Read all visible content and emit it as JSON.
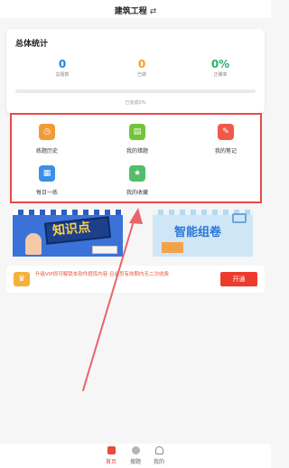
{
  "header": {
    "title": "建筑工程",
    "switch_icon": "swap-icon"
  },
  "stats": {
    "heading": "总体统计",
    "items": [
      {
        "value": "0",
        "label": "总题数"
      },
      {
        "value": "0",
        "label": "已做"
      },
      {
        "value": "0%",
        "label": "正确率"
      }
    ],
    "progress_fraction": 0,
    "progress_text": "已完成0%",
    "colors": {
      "total": "#2b7fe0",
      "done": "#f0a020",
      "rate": "#27b36a"
    }
  },
  "features": [
    {
      "label": "练题历史",
      "icon": "history-icon",
      "color": "#f29a3a"
    },
    {
      "label": "我的错题",
      "icon": "book-icon",
      "color": "#72c43b"
    },
    {
      "label": "我的笔记",
      "icon": "pen-icon",
      "color": "#ee5a4a"
    },
    {
      "label": "每日一练",
      "icon": "calendar-icon",
      "color": "#3b8fe8"
    },
    {
      "label": "我的收藏",
      "icon": "folder-star-icon",
      "color": "#53be6a"
    }
  ],
  "banners": {
    "left": {
      "text": "知识点"
    },
    "right": {
      "text": "智能组卷"
    }
  },
  "vip": {
    "text": "升级VIP即可解锁本软件题库内容 且会员有效期内无二次收费",
    "button": "开通"
  },
  "tabbar": [
    {
      "label": "首页",
      "active": true
    },
    {
      "label": "搜题",
      "active": false
    },
    {
      "label": "我的",
      "active": false
    }
  ],
  "accent": "#e84a3c"
}
